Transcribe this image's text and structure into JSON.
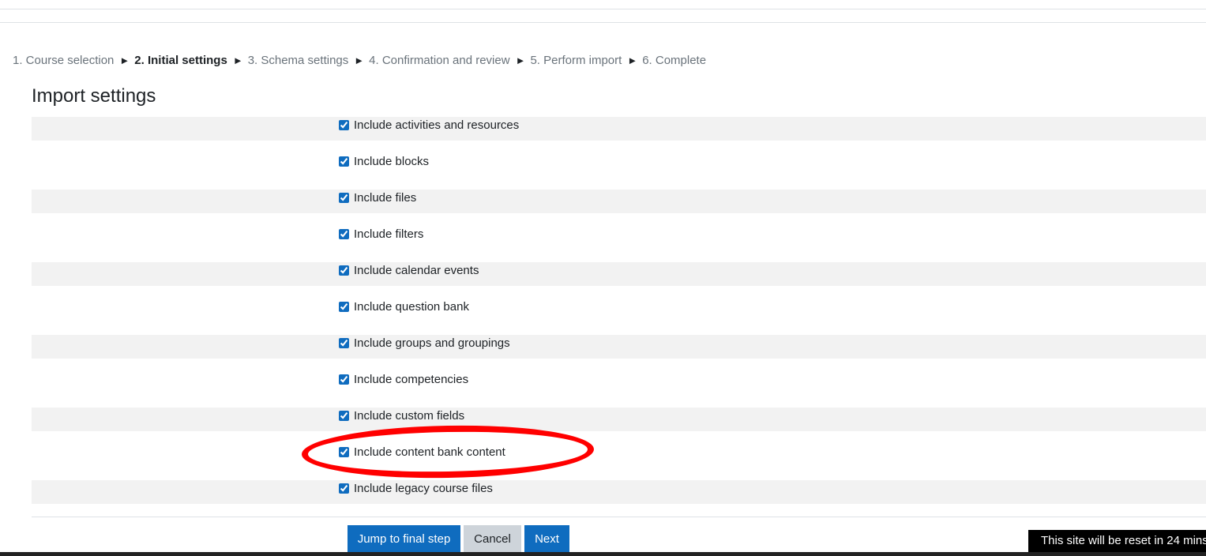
{
  "breadcrumb": {
    "steps": [
      "1. Course selection",
      "2. Initial settings",
      "3. Schema settings",
      "4. Confirmation and review",
      "5. Perform import",
      "6. Complete"
    ],
    "separator": "►",
    "current_index": 1
  },
  "page": {
    "title": "Import settings"
  },
  "settings": [
    {
      "label": "Include activities and resources",
      "checked": true
    },
    {
      "label": "Include blocks",
      "checked": true
    },
    {
      "label": "Include files",
      "checked": true
    },
    {
      "label": "Include filters",
      "checked": true
    },
    {
      "label": "Include calendar events",
      "checked": true
    },
    {
      "label": "Include question bank",
      "checked": true
    },
    {
      "label": "Include groups and groupings",
      "checked": true
    },
    {
      "label": "Include competencies",
      "checked": true
    },
    {
      "label": "Include custom fields",
      "checked": true
    },
    {
      "label": "Include content bank content",
      "checked": true
    },
    {
      "label": "Include legacy course files",
      "checked": true
    }
  ],
  "buttons": {
    "jump": "Jump to final step",
    "cancel": "Cancel",
    "next": "Next"
  },
  "notice": "This site will be reset in 24 mins",
  "colors": {
    "primary": "#0f6cbf",
    "secondary": "#ced4da",
    "annotation": "#ff0000",
    "row_shade": "#f2f2f2"
  }
}
